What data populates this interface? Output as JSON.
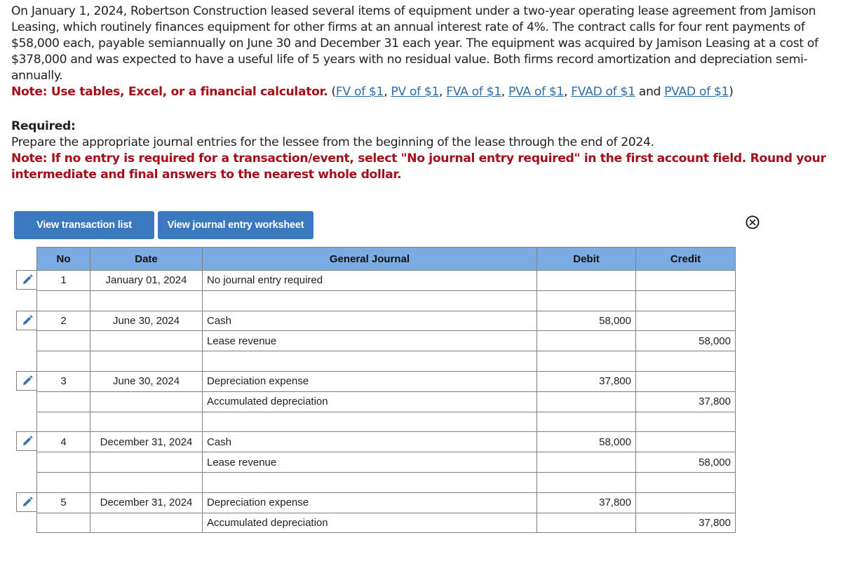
{
  "problem": {
    "text": "On January 1, 2024, Robertson Construction leased several items of equipment under a two-year operating lease agreement from Jamison Leasing, which routinely finances equipment for other firms at an annual interest rate of 4%. The contract calls for four rent payments of $58,000 each, payable semiannually on June 30 and December 31 each year. The equipment was acquired by Jamison Leasing at a cost of $378,000 and was expected to have a useful life of 5 years with no residual value. Both firms record amortization and depreciation semi-annually.",
    "note": "Note: Use tables, Excel, or a financial calculator.",
    "links": {
      "open": " (",
      "fv": "FV of $1",
      "pv": "PV of $1",
      "fva": "FVA of $1",
      "pva": "PVA of $1",
      "fvad": "FVAD of $1",
      "and": " and ",
      "pvad": "PVAD of $1",
      "close": ")",
      "sep": ", "
    }
  },
  "required": {
    "title": "Required:",
    "instruction": "Prepare the appropriate journal entries for the lessee from the beginning of the lease through the end of 2024.",
    "note": "Note: If no entry is required for a transaction/event, select \"No journal entry required\" in the first account field. Round your intermediate and final answers to the nearest whole dollar."
  },
  "buttons": {
    "transaction_list": "View transaction list",
    "journal_worksheet": "View journal entry worksheet"
  },
  "table": {
    "headers": {
      "no": "No",
      "date": "Date",
      "journal": "General Journal",
      "debit": "Debit",
      "credit": "Credit"
    },
    "entries": [
      {
        "no": "1",
        "date": "January 01, 2024",
        "lines": [
          {
            "account": "No journal entry required",
            "debit": "",
            "credit": ""
          }
        ]
      },
      {
        "no": "2",
        "date": "June 30, 2024",
        "lines": [
          {
            "account": "Cash",
            "debit": "58,000",
            "credit": ""
          },
          {
            "account": "Lease revenue",
            "debit": "",
            "credit": "58,000"
          }
        ]
      },
      {
        "no": "3",
        "date": "June 30, 2024",
        "lines": [
          {
            "account": "Depreciation expense",
            "debit": "37,800",
            "credit": ""
          },
          {
            "account": "Accumulated depreciation",
            "debit": "",
            "credit": "37,800"
          }
        ]
      },
      {
        "no": "4",
        "date": "December 31, 2024",
        "lines": [
          {
            "account": "Cash",
            "debit": "58,000",
            "credit": ""
          },
          {
            "account": "Lease revenue",
            "debit": "",
            "credit": "58,000"
          }
        ]
      },
      {
        "no": "5",
        "date": "December 31, 2024",
        "lines": [
          {
            "account": "Depreciation expense",
            "debit": "37,800",
            "credit": ""
          },
          {
            "account": "Accumulated depreciation",
            "debit": "",
            "credit": "37,800"
          }
        ]
      }
    ]
  },
  "colors": {
    "note_red": "#a30f1b",
    "link_blue": "#2f6da6",
    "button_blue": "#3a78c0",
    "header_blue": "#7aace3"
  }
}
